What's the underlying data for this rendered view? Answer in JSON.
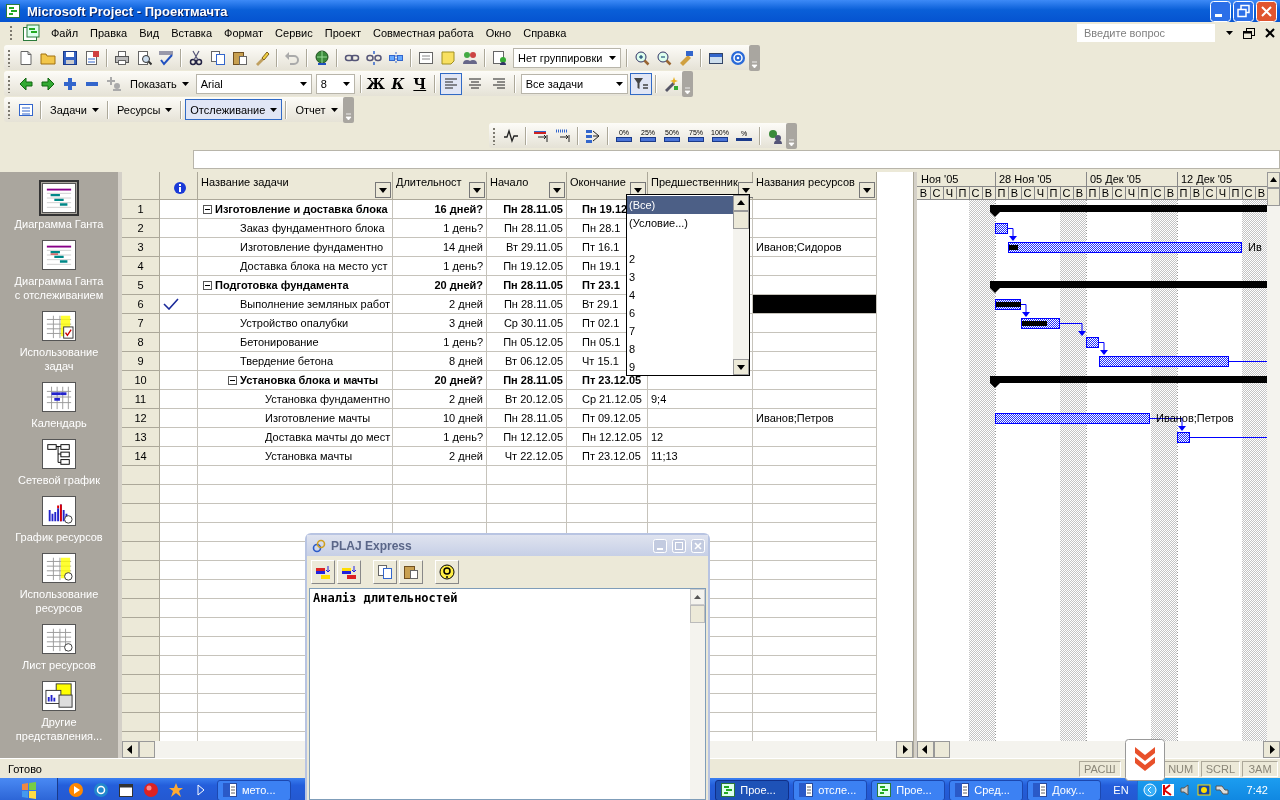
{
  "window": {
    "title": "Microsoft Project - Проектмачта"
  },
  "menu": [
    "Файл",
    "Правка",
    "Вид",
    "Вставка",
    "Формат",
    "Сервис",
    "Проект",
    "Совместная работа",
    "Окно",
    "Справка"
  ],
  "help_search": {
    "placeholder": "Введите вопрос"
  },
  "standard_toolbar": {
    "grouping": "Нет группировки"
  },
  "formatting_toolbar": {
    "show": "Показать",
    "font": "Arial",
    "size": "8",
    "bold": "Ж",
    "italic": "К",
    "underline": "Ч",
    "alignment_buttons": [
      {
        "kind": "left",
        "selected": true
      },
      {
        "kind": "center",
        "selected": false
      },
      {
        "kind": "right",
        "selected": false
      }
    ],
    "filter": "Все задачи",
    "autofilter_on": true
  },
  "view_toolbar": [
    {
      "label": "Задачи",
      "pressed": false
    },
    {
      "label": "Ресурсы",
      "pressed": false
    },
    {
      "label": "Отслеживание",
      "pressed": true
    },
    {
      "label": "Отчет",
      "pressed": false
    }
  ],
  "tracking_toolbar": {
    "percent_buttons": [
      "0%",
      "25%",
      "50%",
      "75%",
      "100%"
    ],
    "update_label": "%"
  },
  "view_bar": [
    {
      "label": "Диаграмма Ганта",
      "selected": true
    },
    {
      "label": "Диаграмма Ганта с отслеживанием",
      "selected": false
    },
    {
      "label": "Использование задач",
      "selected": false
    },
    {
      "label": "Календарь",
      "selected": false
    },
    {
      "label": "Сетевой график",
      "selected": false
    },
    {
      "label": "График ресурсов",
      "selected": false
    },
    {
      "label": "Использование ресурсов",
      "selected": false
    },
    {
      "label": "Лист ресурсов",
      "selected": false
    },
    {
      "label": "Другие представления...",
      "selected": false
    }
  ],
  "table": {
    "columns": [
      "Название задачи",
      "Длительност",
      "Начало",
      "Окончание",
      "Предшественник",
      "Названия ресурсов"
    ],
    "tasks": [
      {
        "num": "1",
        "kind": "summary",
        "expanded": true,
        "name": "Изготовление и доставка блока",
        "duration": "16 дней?",
        "start": "Пн 28.11.05",
        "finish": "Пн 19.12",
        "completed": false,
        "resources_selected": false,
        "children": [
          {
            "num": "2",
            "kind": "task",
            "name": "Заказ фундаментного блока",
            "duration": "1 день?",
            "start": "Пн 28.11.05",
            "finish": "Пн 28.1",
            "completed": false,
            "resources_selected": false
          },
          {
            "num": "3",
            "kind": "task",
            "name": "Изготовление фундаментно",
            "duration": "14 дней",
            "start": "Вт 29.11.05",
            "finish": "Пт 16.1",
            "resources": "Иванов;Сидоров",
            "gantt_label": "Ив",
            "completed": false,
            "resources_selected": false
          },
          {
            "num": "4",
            "kind": "task",
            "name": "Доставка блока на место уст",
            "duration": "1 день?",
            "start": "Пн 19.12.05",
            "finish": "Пн 19.1",
            "completed": false,
            "resources_selected": false
          }
        ]
      },
      {
        "num": "5",
        "kind": "summary",
        "expanded": true,
        "name": "Подготовка фундамента",
        "duration": "20 дней?",
        "start": "Пн 28.11.05",
        "finish": "Пт 23.1",
        "completed": false,
        "resources_selected": false,
        "children": [
          {
            "num": "6",
            "kind": "task",
            "name": "Выполнение земляных работ",
            "duration": "2 дней",
            "start": "Пн 28.11.05",
            "finish": "Вт 29.1",
            "completed": true,
            "resources_selected": true
          },
          {
            "num": "7",
            "kind": "task",
            "name": "Устройство опалубки",
            "duration": "3 дней",
            "start": "Ср 30.11.05",
            "finish": "Пт 02.1",
            "completed": false,
            "resources_selected": false
          },
          {
            "num": "8",
            "kind": "task",
            "name": "Бетонирование",
            "duration": "1 день?",
            "start": "Пн 05.12.05",
            "finish": "Пн 05.1",
            "completed": false,
            "resources_selected": false
          },
          {
            "num": "9",
            "kind": "task",
            "name": "Твердение бетона",
            "duration": "8 дней",
            "start": "Вт 06.12.05",
            "finish": "Чт 15.1",
            "completed": false,
            "resources_selected": false
          },
          {
            "num": "10",
            "kind": "summary",
            "expanded": true,
            "name": "Установка блока и мачты",
            "duration": "20 дней?",
            "start": "Пн 28.11.05",
            "finish": "Пт 23.12.05",
            "completed": false,
            "resources_selected": false,
            "children": [
              {
                "num": "11",
                "kind": "task",
                "name": "Установка фундаментно",
                "duration": "2 дней",
                "start": "Вт 20.12.05",
                "finish": "Ср 21.12.05",
                "predecessors": "9;4",
                "completed": false,
                "resources_selected": false
              },
              {
                "num": "12",
                "kind": "task",
                "name": "Изготовление мачты",
                "duration": "10 дней",
                "start": "Пн 28.11.05",
                "finish": "Пт 09.12.05",
                "resources": "Иванов;Петров",
                "gantt_label": "Иванов;Петров",
                "completed": false,
                "resources_selected": false
              },
              {
                "num": "13",
                "kind": "task",
                "name": "Доставка мачты до мест",
                "duration": "1 день?",
                "start": "Пн 12.12.05",
                "finish": "Пн 12.12.05",
                "predecessors": "12",
                "completed": false,
                "resources_selected": false
              },
              {
                "num": "14",
                "kind": "task",
                "name": "Установка мачты",
                "duration": "2 дней",
                "start": "Чт 22.12.05",
                "finish": "Пт 23.12.05",
                "predecessors": "11;13",
                "completed": false,
                "resources_selected": false
              }
            ]
          }
        ]
      }
    ]
  },
  "filter_dropdown": {
    "items": [
      {
        "label": "(Все)",
        "kind": "special",
        "selected": true
      },
      {
        "label": "(Условие...)",
        "kind": "special",
        "selected": false
      },
      {
        "label": "2",
        "kind": "value",
        "selected": false
      },
      {
        "label": "3",
        "kind": "value",
        "selected": false
      },
      {
        "label": "4",
        "kind": "value",
        "selected": false
      },
      {
        "label": "6",
        "kind": "value",
        "selected": false
      },
      {
        "label": "7",
        "kind": "value",
        "selected": false
      },
      {
        "label": "8",
        "kind": "value",
        "selected": false
      },
      {
        "label": "9",
        "kind": "value",
        "selected": false
      }
    ]
  },
  "gantt": {
    "weeks": [
      "Ноя '05",
      "28 Ноя '05",
      "05 Дек '05",
      "12 Дек '05"
    ],
    "days": [
      "В",
      "С",
      "Ч",
      "П",
      "С",
      "В",
      "П",
      "В",
      "С",
      "Ч",
      "П",
      "С",
      "В",
      "П",
      "В",
      "С",
      "Ч",
      "П",
      "С",
      "В",
      "П",
      "В",
      "С",
      "Ч",
      "П",
      "С",
      "В"
    ]
  },
  "status_bar": {
    "text": "Готово",
    "indicators": [
      {
        "label": "РАСШ",
        "active": false
      },
      {
        "label": "NUM",
        "active": false
      },
      {
        "label": "SCRL",
        "active": false
      },
      {
        "label": "ЗАМ",
        "active": false
      }
    ]
  },
  "taskbar": {
    "tasks": [
      {
        "label": "мето...",
        "kind": "word",
        "selected": false
      },
      {
        "label": "Прое...",
        "kind": "project",
        "selected": true
      },
      {
        "label": "отсле...",
        "kind": "word",
        "selected": false
      },
      {
        "label": "Прое...",
        "kind": "project",
        "selected": false
      },
      {
        "label": "Сред...",
        "kind": "word",
        "selected": false
      },
      {
        "label": "Доку...",
        "kind": "word",
        "selected": false
      }
    ],
    "language": "EN",
    "clock": "7:42"
  },
  "plaj_window": {
    "title": "PLAJ Express",
    "text": "Аналіз длительностей"
  }
}
